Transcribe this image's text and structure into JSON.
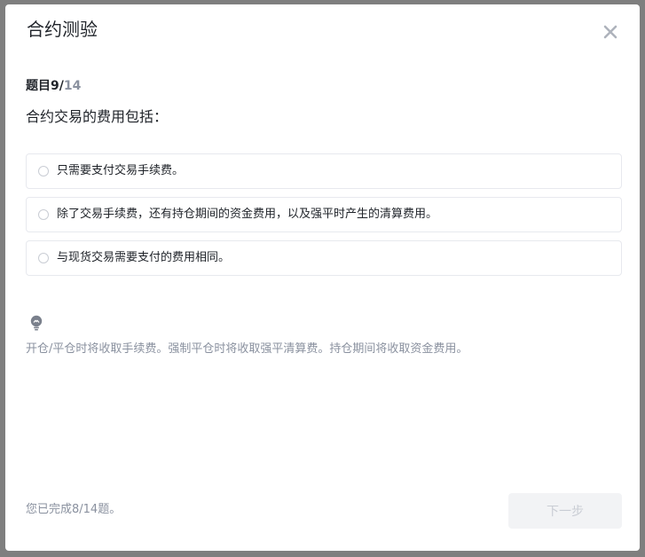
{
  "modal": {
    "title": "合约测验",
    "close_icon": "close-icon"
  },
  "progress": {
    "prefix": "题目",
    "current": "9/",
    "total": "14"
  },
  "question": {
    "text": "合约交易的费用包括："
  },
  "options": [
    {
      "label": "只需要支付交易手续费。"
    },
    {
      "label": "除了交易手续费，还有持仓期间的资金费用，以及强平时产生的清算费用。"
    },
    {
      "label": "与现货交易需要支付的费用相同。"
    }
  ],
  "hint": {
    "icon": "lightbulb-icon",
    "text": "开仓/平仓时将收取手续费。强制平仓时将收取强平清算费。持仓期间将收取资金费用。"
  },
  "footer": {
    "status": "您已完成8/14题。",
    "next_label": "下一步"
  },
  "colors": {
    "text_primary": "#1f2329",
    "text_secondary": "#8a919f",
    "border": "#e7e9ee",
    "button_disabled_bg": "#f2f3f5",
    "button_disabled_text": "#c9cdd4",
    "overlay": "#7f7f7f"
  }
}
